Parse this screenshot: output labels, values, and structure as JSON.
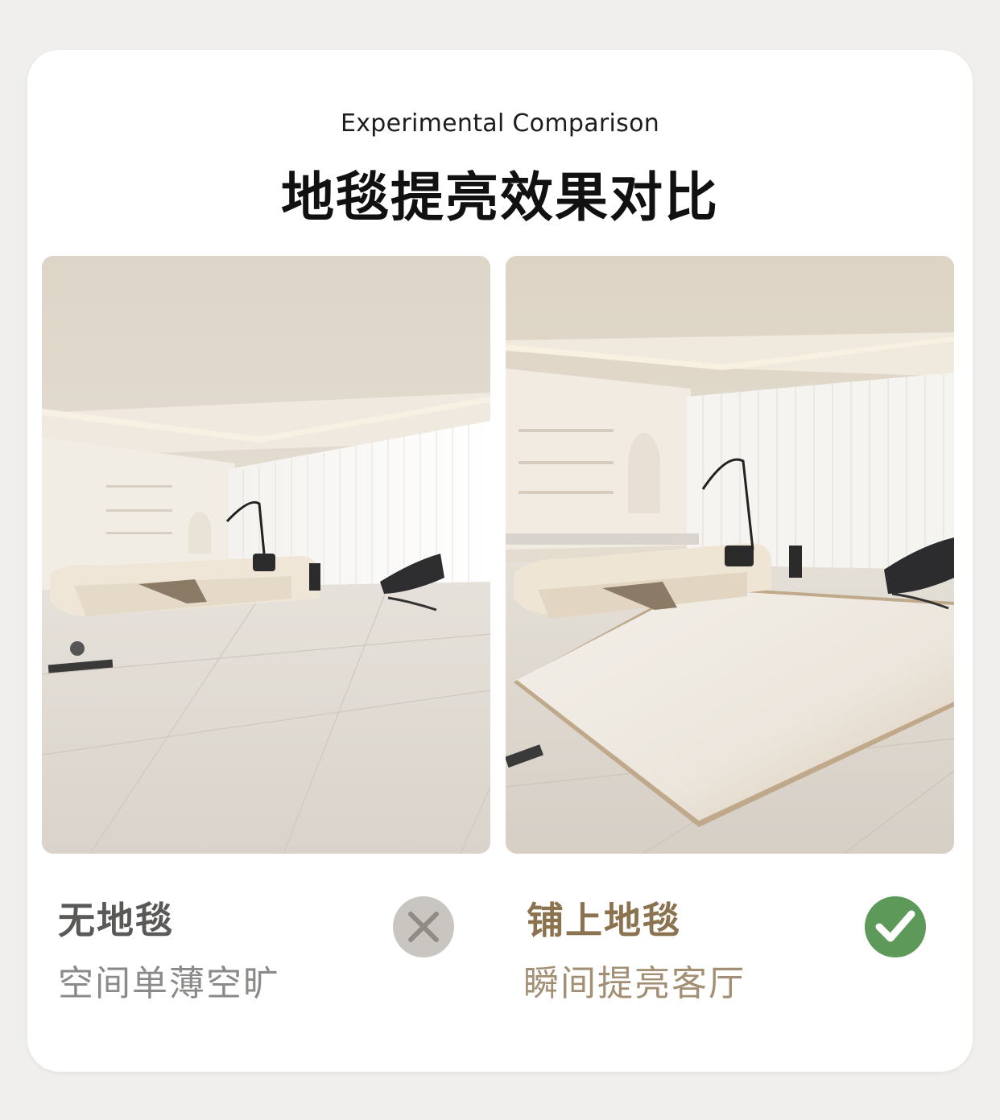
{
  "header": {
    "subtitle": "Experimental Comparison",
    "title": "地毯提亮效果对比"
  },
  "comparison": {
    "without": {
      "label": "无地毯",
      "caption": "空间单薄空旷",
      "badge_icon": "x-mark-icon",
      "badge_color": "#c9c6c1"
    },
    "with": {
      "label": "铺上地毯",
      "caption": "瞬间提亮客厅",
      "badge_icon": "check-icon",
      "badge_color": "#5d9a5a"
    }
  },
  "colors": {
    "without_label": "#5a5958",
    "with_label": "#8c7350",
    "card_bg": "#ffffff"
  }
}
